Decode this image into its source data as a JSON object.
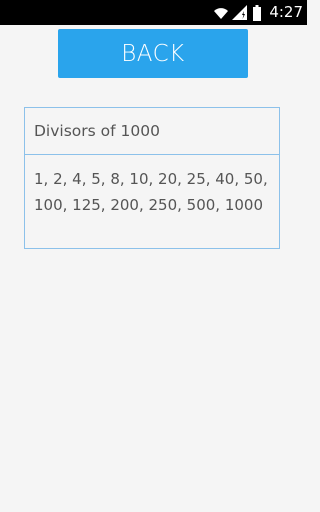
{
  "status_bar": {
    "time": "4:27",
    "icons": [
      "wifi-icon",
      "signal-icon",
      "battery-icon"
    ],
    "background": "#000000"
  },
  "back_button": {
    "label": "BACK",
    "color": "#2aa4ec"
  },
  "result": {
    "title": "Divisors of 1000",
    "divisors": "1, 2, 4, 5, 8, 10, 20, 25, 40, 50, 100, 125, 200, 250, 500, 1000",
    "border_color": "#8cc1ea"
  }
}
